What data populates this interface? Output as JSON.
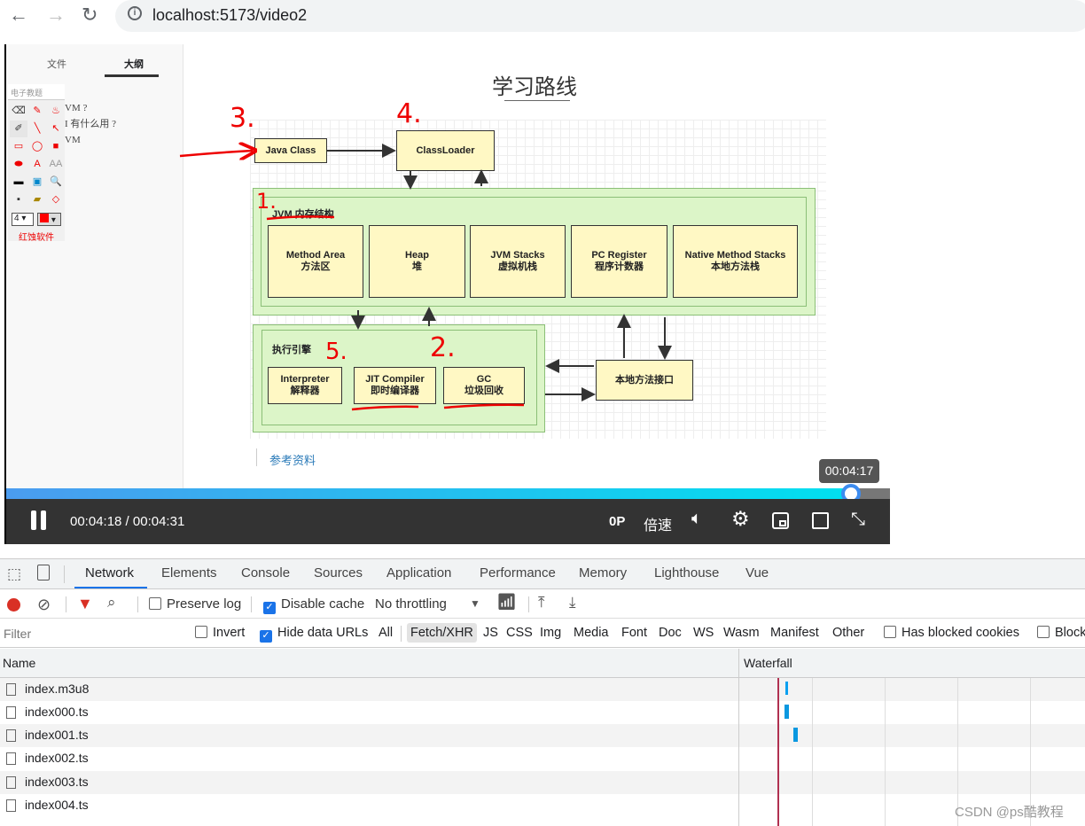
{
  "browser": {
    "url": "localhost:5173/video2"
  },
  "video": {
    "left_tabs": [
      "文件",
      "大纲"
    ],
    "search_placeholder": "电子教题",
    "outline": [
      "VM ?",
      "I 有什么用 ?",
      "VM"
    ],
    "tool_size": "4",
    "tool_brand": "红蚀软件",
    "slide_title": "学习路线",
    "diagram": {
      "java_class": "Java Class",
      "classloader": "ClassLoader",
      "jvm_memory": "JVM 内存结构",
      "areas": [
        [
          "Method Area",
          "方法区"
        ],
        [
          "Heap",
          "堆"
        ],
        [
          "JVM Stacks",
          "虚拟机栈"
        ],
        [
          "PC Register",
          "程序计数器"
        ],
        [
          "Native Method Stacks",
          "本地方法栈"
        ]
      ],
      "exec_engine": "执行引擎",
      "engines": [
        [
          "Interpreter",
          "解释器"
        ],
        [
          "JIT Compiler",
          "即时编译器"
        ],
        [
          "GC",
          "垃圾回收"
        ]
      ],
      "native_interface": "本地方法接口",
      "annotations": [
        "3.",
        "4.",
        "1.",
        "5.",
        "2."
      ]
    },
    "reference": "参考资料",
    "tooltip": "00:04:17",
    "progress": 0.955,
    "time": "00:04:18 / 00:04:31",
    "quality": "0P",
    "speed": "倍速"
  },
  "devtools": {
    "tabs": [
      "Network",
      "Elements",
      "Console",
      "Sources",
      "Application",
      "Performance",
      "Memory",
      "Lighthouse",
      "Vue"
    ],
    "active_tab": "Network",
    "preserve_log": "Preserve log",
    "disable_cache": "Disable cache",
    "throttling": "No throttling",
    "filter_placeholder": "Filter",
    "invert": "Invert",
    "hide_data_urls": "Hide data URLs",
    "types": [
      "All",
      "Fetch/XHR",
      "JS",
      "CSS",
      "Img",
      "Media",
      "Font",
      "Doc",
      "WS",
      "Wasm",
      "Manifest",
      "Other"
    ],
    "active_type": "Fetch/XHR",
    "blocked_cookies": "Has blocked cookies",
    "blocked_requests": "Block",
    "col_name": "Name",
    "col_waterfall": "Waterfall",
    "rows": [
      "index.m3u8",
      "index000.ts",
      "index001.ts",
      "index002.ts",
      "index003.ts",
      "index004.ts"
    ],
    "accent": "#1a73e8"
  },
  "watermark": "CSDN @ps酷教程"
}
